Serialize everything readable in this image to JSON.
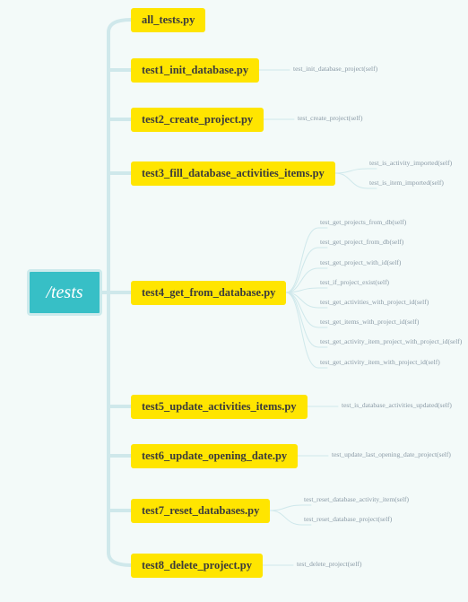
{
  "root": {
    "label": "/tests"
  },
  "files": [
    {
      "name": "all_tests.py",
      "functions": []
    },
    {
      "name": "test1_init_database.py",
      "functions": [
        "test_init_database_project(self)"
      ]
    },
    {
      "name": "test2_create_project.py",
      "functions": [
        "test_create_project(self)"
      ]
    },
    {
      "name": "test3_fill_database_activities_items.py",
      "functions": [
        "test_is_activity_imported(self)",
        "test_is_item_imported(self)"
      ]
    },
    {
      "name": "test4_get_from_database.py",
      "functions": [
        "test_get_projects_from_db(self)",
        "test_get_project_from_db(self)",
        "test_get_project_with_id(self)",
        "test_if_project_exist(self)",
        "test_get_activities_with_project_id(self)",
        "test_get_items_with_project_id(self)",
        "test_get_activity_item_project_with_project_id(self)",
        "test_get_activity_item_with_project_id(self)"
      ]
    },
    {
      "name": "test5_update_activities_items.py",
      "functions": [
        "test_is_database_activities_updated(self)"
      ]
    },
    {
      "name": "test6_update_opening_date.py",
      "functions": [
        "test_update_last_opening_date_project(self)"
      ]
    },
    {
      "name": "test7_reset_databases.py",
      "functions": [
        "test_reset_database_activity_item(self)",
        "test_reset_database_project(self)"
      ]
    },
    {
      "name": "test8_delete_project.py",
      "functions": [
        "test_delete_project(self)"
      ]
    }
  ],
  "colors": {
    "background": "#f3faf9",
    "root_fill": "#37bfc6",
    "file_fill": "#ffe500",
    "connector": "#cfe8eb"
  }
}
